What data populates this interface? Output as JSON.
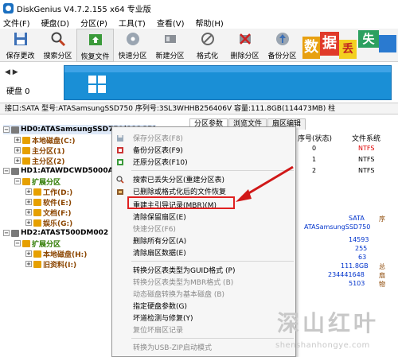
{
  "window": {
    "title": "DiskGenius V4.7.2.155 x64 专业版"
  },
  "menubar": [
    "文件(F)",
    "硬盘(D)",
    "分区(P)",
    "工具(T)",
    "查看(V)",
    "帮助(H)"
  ],
  "toolbar": [
    {
      "label": "保存更改",
      "icon": "save-icon"
    },
    {
      "label": "搜索分区",
      "icon": "search-icon"
    },
    {
      "label": "恢复文件",
      "icon": "recover-icon"
    },
    {
      "label": "快速分区",
      "icon": "quick-partition-icon"
    },
    {
      "label": "新建分区",
      "icon": "new-partition-icon"
    },
    {
      "label": "格式化",
      "icon": "format-icon"
    },
    {
      "label": "删除分区",
      "icon": "delete-partition-icon"
    },
    {
      "label": "备份分区",
      "icon": "backup-partition-icon"
    }
  ],
  "ad_tiles": [
    "数",
    "据",
    "丢",
    "失"
  ],
  "disk_panel": {
    "label": "硬盘 0",
    "colors": {
      "disk": "#1a8fd6",
      "stripe": "#3fa3e6"
    }
  },
  "info_bar": "接口:SATA  型号:ATASamsungSSD750  序列号:3SL3WHHB256406V  容量:111.8GB(114473MB)  柱",
  "tree": {
    "hd0": {
      "label": "HD0:ATASamsungSSD750(112GB)",
      "children": [
        "本地磁盘(C:)",
        "主分区(1)",
        "主分区(2)"
      ]
    },
    "hd1": {
      "label": "HD1:ATAWDCWD5000AAKX",
      "ext": "扩展分区",
      "children": [
        "工作(D:)",
        "软件(E:)",
        "文档(F:)",
        "娱乐(G:)"
      ]
    },
    "hd2": {
      "label": "HD2:ATAST500DM002",
      "ext": "扩展分区",
      "children": [
        "本地磁盘(H:)",
        "旧资料(I:)"
      ]
    }
  },
  "right_pane": {
    "tabs": [
      "分区参数",
      "浏览文件",
      "扇区编辑"
    ],
    "col_seq": "序号(状态)",
    "col_fs": "文件系统",
    "rows": [
      {
        "seq": "0",
        "fs": "NTFS"
      },
      {
        "seq": "1",
        "fs": "NTFS"
      },
      {
        "seq": "2",
        "fs": "NTFS"
      }
    ],
    "iface": "SATA",
    "model": "ATASamsungSSD750",
    "seq_label": "序",
    "values": [
      "14593",
      "255",
      "63",
      "111.8GB",
      "234441648",
      "5103"
    ],
    "side_labels": [
      "总",
      "扇",
      "物"
    ]
  },
  "context_menu": [
    {
      "label": "保存分区表(F8)",
      "enabled": false,
      "icon": "save-icon"
    },
    {
      "label": "备份分区表(F9)",
      "enabled": true,
      "icon": "backup-icon"
    },
    {
      "label": "还原分区表(F10)",
      "enabled": true,
      "icon": "restore-icon"
    },
    {
      "label": "搜索已丢失分区(重建分区表)",
      "enabled": true,
      "icon": "search-icon"
    },
    {
      "label": "已删除或格式化后的文件恢复",
      "enabled": true,
      "icon": "recover-icon"
    },
    {
      "label": "重建主引导记录(MBR)(M)",
      "enabled": true,
      "icon": ""
    },
    {
      "label": "清除保留扇区(E)",
      "enabled": true,
      "icon": ""
    },
    {
      "label": "快速分区(F6)",
      "enabled": false,
      "icon": ""
    },
    {
      "label": "删除所有分区(A)",
      "enabled": true,
      "icon": ""
    },
    {
      "label": "清除扇区数据(E)",
      "enabled": true,
      "icon": ""
    },
    {
      "label": "转换分区表类型为GUID格式 (P)",
      "enabled": true,
      "icon": ""
    },
    {
      "label": "转换分区表类型为MBR格式 (B)",
      "enabled": false,
      "icon": ""
    },
    {
      "label": "动态磁盘转换为基本磁盘 (B)",
      "enabled": false,
      "icon": ""
    },
    {
      "label": "指定硬盘参数(G)",
      "enabled": true,
      "icon": ""
    },
    {
      "label": "坏道检测与修复(Y)",
      "enabled": true,
      "icon": ""
    },
    {
      "label": "复位坏扇区记录",
      "enabled": false,
      "icon": ""
    },
    {
      "label": "转换为USB-ZIP启动模式",
      "enabled": false,
      "icon": ""
    }
  ],
  "watermark": {
    "big": "深山红叶",
    "small": "shenshanhongye.com"
  },
  "colors": {
    "highlight_border": "#e02020",
    "accent_red": "#e00000"
  }
}
